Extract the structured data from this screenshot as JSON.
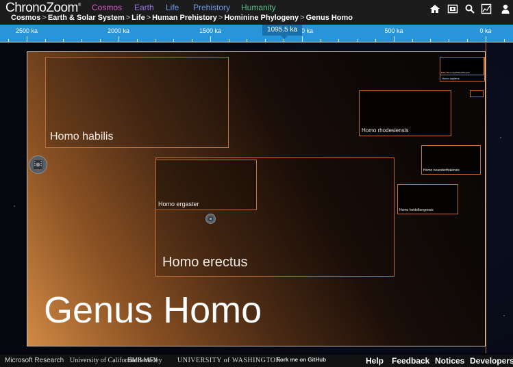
{
  "app": {
    "logo": "ChronoZoom",
    "logo_mark": "®"
  },
  "nav": [
    {
      "label": "Cosmos",
      "color": "#d85dcb"
    },
    {
      "label": "Earth",
      "color": "#9a74e6"
    },
    {
      "label": "Life",
      "color": "#6a9ef0"
    },
    {
      "label": "Prehistory",
      "color": "#6c9ae8"
    },
    {
      "label": "Humanity",
      "color": "#5cc58c"
    }
  ],
  "breadcrumb": [
    "Cosmos",
    "Earth & Solar System",
    "Life",
    "Human Prehistory",
    "Hominine Phylogeny",
    "Genus Homo"
  ],
  "breadcrumb_separator": ">",
  "header_icons": [
    "home-icon",
    "tour-icon",
    "search-icon",
    "chart-icon",
    "user-icon"
  ],
  "timeline": {
    "labels": [
      "2500 ka",
      "2000 ka",
      "1500 ka",
      "1000 ka",
      "500 ka",
      "0 ka"
    ],
    "current": "1095.5 ka",
    "accent": "#2a94d9"
  },
  "exhibit": {
    "title": "Genus Homo",
    "children": [
      {
        "label": "Homo habilis"
      },
      {
        "label": "Homo erectus"
      },
      {
        "label": "Homo ergaster"
      },
      {
        "label": "Homo rhodesiensis"
      },
      {
        "label": "Homo neanderthalensis"
      },
      {
        "label": "Homo heidelbergensis"
      },
      {
        "label": "Homo sapiens"
      },
      {
        "label": "Early Stone Age/Paleolithic Era"
      }
    ]
  },
  "footer": {
    "partners": [
      "Microsoft Research",
      "University of California Berkeley",
      "ВМК МГУ",
      "UNIVERSITY of WASHINGTON",
      "Fork me on GitHub"
    ],
    "links": [
      "Help",
      "Feedback",
      "Notices",
      "Developers"
    ]
  }
}
